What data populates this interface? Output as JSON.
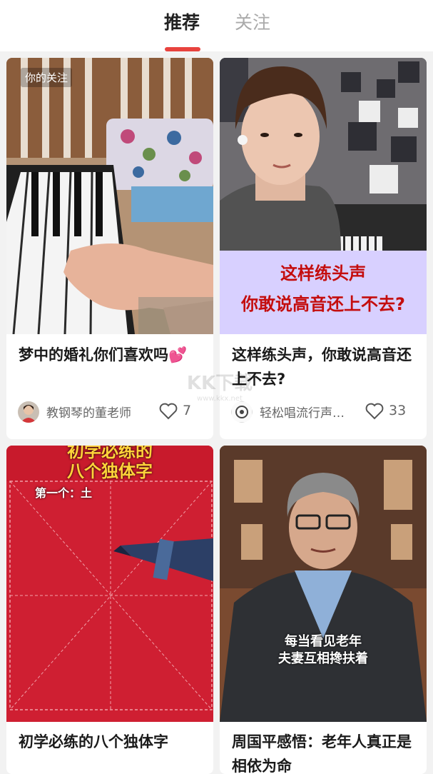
{
  "tabs": {
    "recommended": "推荐",
    "following": "关注"
  },
  "accent": "#e8433e",
  "watermark": {
    "logo": "KK下载",
    "url": "www.kkx.net"
  },
  "cards": [
    {
      "tag": "你的关注",
      "title": "梦中的婚礼你们喜欢吗💕",
      "author": "教钢琴的董老师",
      "likes": "7",
      "icon": "heart-outline-icon"
    },
    {
      "caption_line1": "这样练头声",
      "caption_line2": "你敢说高音还上不去?",
      "title": "这样练头声，你敢说高音还上不去?",
      "author": "轻松唱流行声…",
      "likes": "33",
      "icon": "heart-outline-icon"
    },
    {
      "overlay_title_line1": "初学必练的",
      "overlay_title_line2": "八个独体字",
      "overlay_sub": "第一个：土",
      "title": "初学必练的八个独体字"
    },
    {
      "overlay_line1": "每当看见老年",
      "overlay_line2": "夫妻互相搀扶着",
      "title": "周国平感悟：老年人真正是相依为命"
    }
  ]
}
